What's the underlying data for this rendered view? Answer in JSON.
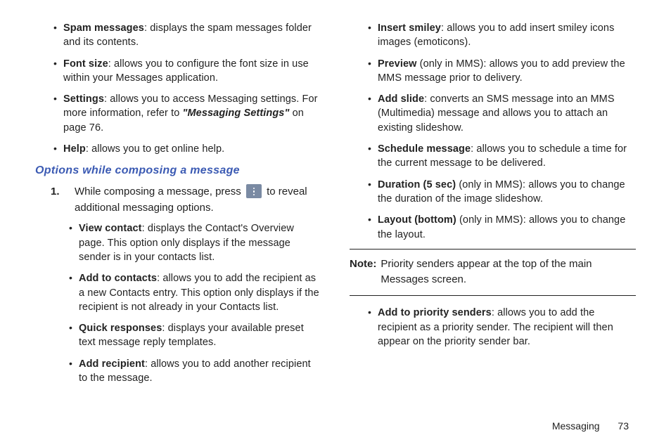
{
  "col1": {
    "topBullets": [
      {
        "b": "Spam messages",
        "t": ": displays the spam messages folder and its contents."
      },
      {
        "b": "Font size",
        "t": ": allows you to configure the font size in use within your Messages application."
      },
      {
        "b": "Settings",
        "t": ": allows you to access Messaging settings. For more information, refer to ",
        "ref": "\"Messaging Settings\"",
        "tail": " on page 76."
      },
      {
        "b": "Help",
        "t": ": allows you to get online help."
      }
    ],
    "heading": "Options while composing a message",
    "stepNum": "1.",
    "stepPre": "While composing a message, press ",
    "stepPost": " to reveal additional messaging options.",
    "stepBullets": [
      {
        "b": "View contact",
        "t": ": displays the Contact's Overview page. This option only displays if the message sender is in your contacts list."
      },
      {
        "b": "Add to contacts",
        "t": ": allows you to add the recipient as a new Contacts entry. This option only displays if the recipient is not already in your Contacts list."
      },
      {
        "b": "Quick responses",
        "t": ": displays your available preset text message reply templates."
      },
      {
        "b": "Add recipient",
        "t": ": allows you to add another recipient to the message."
      }
    ]
  },
  "col2": {
    "topBullets": [
      {
        "b": "Insert smiley",
        "t": ": allows you to add insert smiley icons images (emoticons)."
      },
      {
        "b": "Preview",
        "t": " (only in MMS): allows you to add preview the MMS message prior to delivery."
      },
      {
        "b": "Add slide",
        "t": ": converts an SMS message into an MMS (Multimedia) message and allows you to attach an existing slideshow."
      },
      {
        "b": "Schedule message",
        "t": ": allows you to schedule a time for the current message to be delivered."
      },
      {
        "b": "Duration (5 sec)",
        "t": " (only in MMS): allows you to change the duration of the image slideshow."
      },
      {
        "b": "Layout (bottom)",
        "t": " (only in MMS): allows you to change the layout."
      }
    ],
    "noteLabel": "Note:",
    "noteText": "Priority senders appear at the top of the main Messages screen.",
    "afterNote": [
      {
        "b": "Add to priority senders",
        "t": ": allows you to add the recipient as a priority sender. The recipient will then appear on the priority sender bar."
      }
    ]
  },
  "footer": {
    "section": "Messaging",
    "page": "73"
  }
}
